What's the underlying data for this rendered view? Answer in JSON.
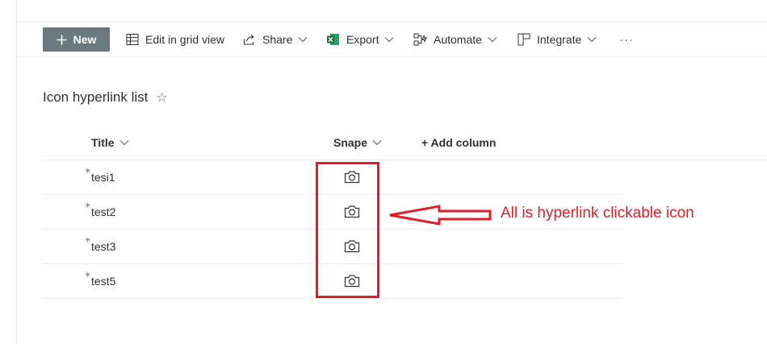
{
  "toolbar": {
    "new_label": "New",
    "edit_grid_label": "Edit in grid view",
    "share_label": "Share",
    "export_label": "Export",
    "automate_label": "Automate",
    "integrate_label": "Integrate",
    "more_label": "···"
  },
  "list": {
    "title": "Icon hyperlink list",
    "favorite_icon": "star-icon"
  },
  "columns": {
    "title": "Title",
    "snape": "Snape",
    "add_column": "+ Add column"
  },
  "rows": [
    {
      "title": "tesi1",
      "new_mark": "✳",
      "snape_icon": "camera-icon"
    },
    {
      "title": "test2",
      "new_mark": "✳",
      "snape_icon": "camera-icon"
    },
    {
      "title": "test3",
      "new_mark": "✳",
      "snape_icon": "camera-icon"
    },
    {
      "title": "test5",
      "new_mark": "✳",
      "snape_icon": "camera-icon"
    }
  ],
  "annotation": {
    "text": "All is hyperlink clickable icon",
    "color": "#e01e2b"
  },
  "colors": {
    "new_button_bg": "#69797e",
    "excel_green": "#1d6f42"
  }
}
